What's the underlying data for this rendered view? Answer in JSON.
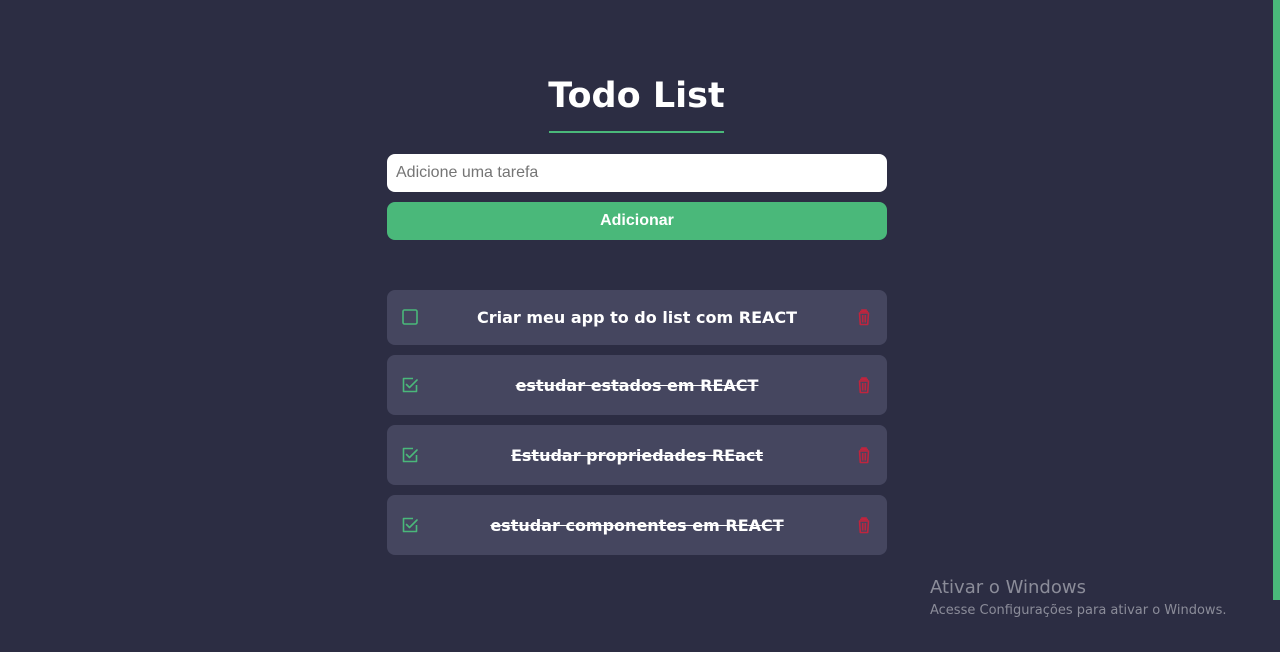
{
  "app": {
    "title": "Todo List"
  },
  "form": {
    "placeholder": "Adicione uma tarefa",
    "value": "",
    "add_label": "Adicionar"
  },
  "todos": [
    {
      "text": "Criar meu app to do list com REACT",
      "completed": false
    },
    {
      "text": "estudar estados em REACT",
      "completed": true
    },
    {
      "text": "Estudar propriedades REact",
      "completed": true
    },
    {
      "text": "estudar componentes em REACT",
      "completed": true
    }
  ],
  "icons": {
    "checkbox": "square-icon",
    "checked": "checkbox-checked-icon",
    "delete": "trash-icon"
  },
  "colors": {
    "background": "#2c2d43",
    "accent": "#4ab87a",
    "card": "#45465f",
    "delete": "#c0243e"
  },
  "watermark": {
    "title": "Ativar o Windows",
    "subtitle": "Acesse Configurações para ativar o Windows."
  }
}
